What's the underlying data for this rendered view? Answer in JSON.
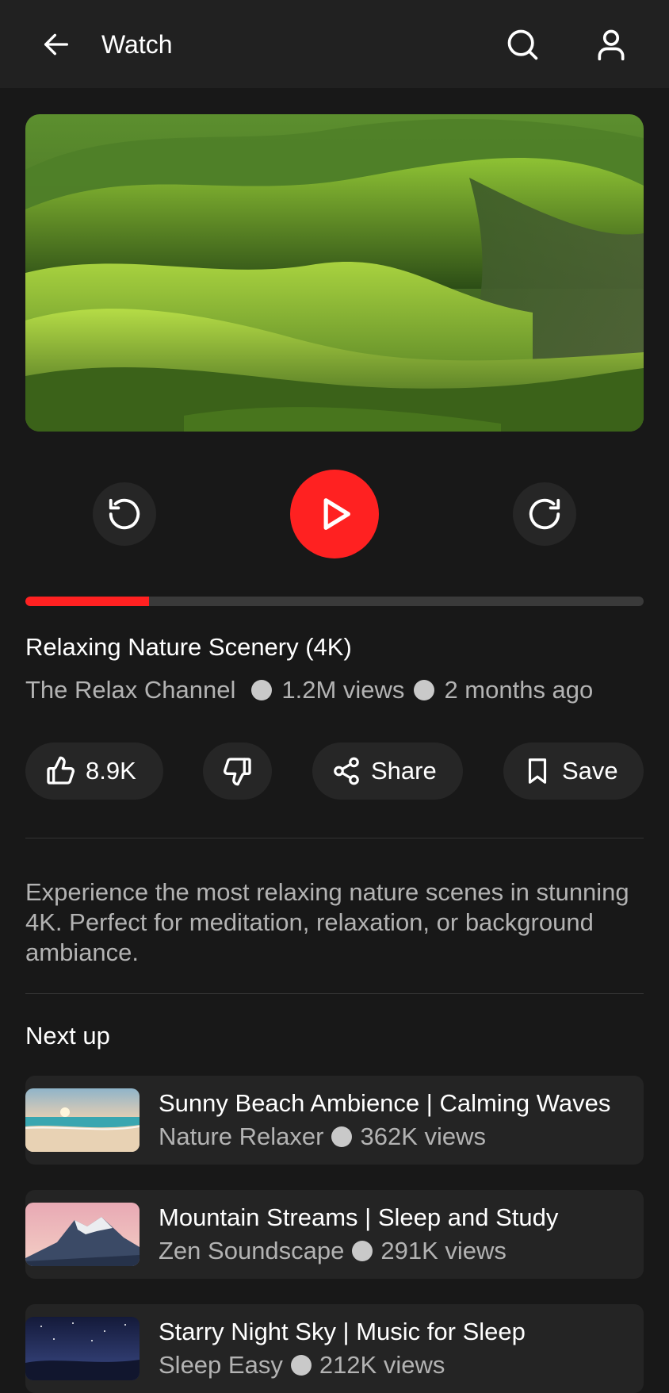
{
  "header": {
    "title": "Watch",
    "icons": [
      "arrow-left-icon",
      "search-icon",
      "user-icon"
    ]
  },
  "player": {
    "icons": [
      "rewind-icon",
      "play-icon",
      "forward-icon"
    ],
    "progress": 0.2
  },
  "video": {
    "title": "Relaxing Nature Scenery (4K)",
    "channel": "The Relax Channel",
    "views": "1.2M views",
    "age": "2 months ago",
    "description": "Experience the most relaxing nature scenes in stunning 4K. Perfect for meditation, relaxation, or background ambiance."
  },
  "actions": {
    "like_count": "8.9K",
    "share_label": "Share",
    "save_label": "Save",
    "icons": [
      "thumbs-up-icon",
      "thumbs-down-icon",
      "share-icon",
      "bookmark-icon"
    ]
  },
  "next_up": {
    "heading": "Next up",
    "items": [
      {
        "title": "Sunny Beach Ambience | Calming Waves",
        "channel": "Nature Relaxer",
        "views": "362K views"
      },
      {
        "title": "Mountain Streams | Sleep and Study",
        "channel": "Zen Soundscape",
        "views": "291K views"
      },
      {
        "title": "Starry Night Sky | Music for Sleep",
        "channel": "Sleep Easy",
        "views": "212K views"
      }
    ]
  },
  "colors": {
    "background": "#181818",
    "header": "#212121",
    "accent": "#ff2121",
    "surface": "#262626",
    "secondary_text": "#b3b3b3"
  }
}
